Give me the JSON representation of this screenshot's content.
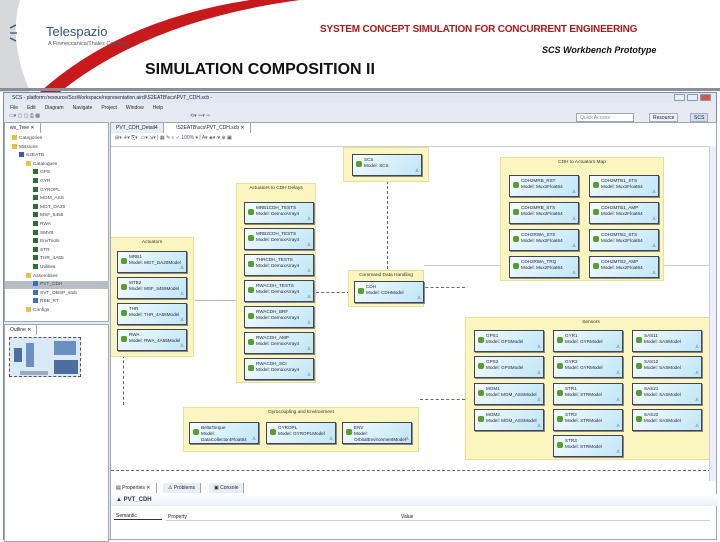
{
  "slide": {
    "logo_name": "Telespazio",
    "logo_sub": "A Finmeccanica/Thales Company",
    "title": "SYSTEM CONCEPT SIMULATION FOR CONCURRENT ENGINEERING",
    "subtitle": "SCS Workbench Prototype",
    "heading": "SIMULATION COMPOSITION II",
    "accent": "#c8191c"
  },
  "window": {
    "title": "SCS - platform:/resource/ScsWorkspace/representation.aird/\\S2EATB\\scs\\PVT_CDH.scb -",
    "menu": [
      "File",
      "Edit",
      "Diagram",
      "Navigate",
      "Project",
      "Window",
      "Help"
    ],
    "quick_access": "Quick Access",
    "persp_resource": "Resource",
    "persp_scs": "SCS"
  },
  "tree": {
    "tab": "ws_Tree",
    "items": [
      {
        "label": "Categories",
        "d": 1,
        "ic": "folder"
      },
      {
        "label": "Missions",
        "d": 1,
        "ic": "folder"
      },
      {
        "label": "S2EATB",
        "d": 2,
        "ic": "mission"
      },
      {
        "label": "Catalogues",
        "d": 3,
        "ic": "folder"
      },
      {
        "label": "GPS",
        "d": 4,
        "ic": "cat"
      },
      {
        "label": "GYR",
        "d": 4,
        "ic": "cat"
      },
      {
        "label": "GYROPL",
        "d": 4,
        "ic": "cat"
      },
      {
        "label": "MGM_ASS",
        "d": 4,
        "ic": "cat"
      },
      {
        "label": "MGT_DA20",
        "d": 4,
        "ic": "cat"
      },
      {
        "label": "MSF_5455",
        "d": 4,
        "ic": "cat"
      },
      {
        "label": "RWA",
        "d": 4,
        "ic": "cat"
      },
      {
        "label": "SMVB",
        "d": 4,
        "ic": "cat"
      },
      {
        "label": "EnvTools",
        "d": 4,
        "ic": "cat"
      },
      {
        "label": "STR",
        "d": 4,
        "ic": "cat"
      },
      {
        "label": "THR_4A55",
        "d": 4,
        "ic": "cat"
      },
      {
        "label": "Utilities",
        "d": 4,
        "ic": "cat"
      },
      {
        "label": "Assemblies",
        "d": 3,
        "ic": "folder"
      },
      {
        "label": "PVT_CDH",
        "d": 4,
        "ic": "asm",
        "sel": true
      },
      {
        "label": "SVT_OBSP_stub",
        "d": 4,
        "ic": "asm"
      },
      {
        "label": "RBB_RT",
        "d": 4,
        "ic": "asm"
      },
      {
        "label": "Configs",
        "d": 3,
        "ic": "folder"
      }
    ]
  },
  "outline": {
    "tab": "Outline"
  },
  "editor": {
    "tabs": [
      "PVT_CDH_Detail4",
      "\\S2EATB\\scs\\PVT_CDH.scb"
    ],
    "zoom": "100%"
  },
  "diagram": {
    "containers": [
      {
        "id": "scs",
        "title": "",
        "cards": [
          {
            "name": "SCS",
            "model": "Model: SCS"
          }
        ]
      },
      {
        "id": "map",
        "title": "CDH to Actuators Map",
        "cards": [
          {
            "name": "CDH2MRB_RST",
            "model": "Model: Mux2Float64"
          },
          {
            "name": "CDH2MTB1_STS",
            "model": "Model: Mux2Float64"
          },
          {
            "name": "CDH2MRB_STS",
            "model": "Model: Mux2Float64"
          },
          {
            "name": "CDH2MTB1_AMP",
            "model": "Model: Mux2Float64"
          },
          {
            "name": "CDH2RWA_STS",
            "model": "Model: Mux2Float64"
          },
          {
            "name": "CDH2MTB2_STS",
            "model": "Model: Mux2Float64"
          },
          {
            "name": "CDH2RWA_TRQ",
            "model": "Model: Mux2Float64"
          },
          {
            "name": "CDH2MTB2_AMP",
            "model": "Model: Mux2Float64"
          }
        ]
      },
      {
        "id": "delays",
        "title": "Actuators to CDH Delays",
        "cards": [
          {
            "name": "MRB1CDH_TESTS",
            "model": "Model: DemuxArray4"
          },
          {
            "name": "MRB2CDH_TESTS",
            "model": "Model: DemuxArray4"
          },
          {
            "name": "THRCDH_TESTS",
            "model": "Model: DemuxArray4"
          },
          {
            "name": "RWACDH_TESTS",
            "model": "Model: DemuxArray4"
          },
          {
            "name": "RWACDH_BRF",
            "model": "Model: DemuxArray4"
          },
          {
            "name": "RWACDH_AMP",
            "model": "Model: DemuxArray4"
          },
          {
            "name": "RWACDH_SCI",
            "model": "Model: DemuxArray4"
          }
        ]
      },
      {
        "id": "actuators",
        "title": "Actuators",
        "cards": [
          {
            "name": "MRB1",
            "model": "Model: MGT_DA20Model"
          },
          {
            "name": "MTB2",
            "model": "Model: MSF_5455Model"
          },
          {
            "name": "THR",
            "model": "Model: THR_4A55Model"
          },
          {
            "name": "RWA",
            "model": "Model: RWA_4A55Model"
          }
        ]
      },
      {
        "id": "cdh",
        "title": "Command Data Handling",
        "cards": [
          {
            "name": "CDH",
            "model": "Model: CDHModel"
          }
        ]
      },
      {
        "id": "sensors",
        "title": "Sensors",
        "cards": [
          {
            "name": "GPS1",
            "model": "Model: GPSModel"
          },
          {
            "name": "GYR1",
            "model": "Model: GYRModel"
          },
          {
            "name": "SAS11",
            "model": "Model: SASModel"
          },
          {
            "name": "GPS2",
            "model": "Model: GPSModel"
          },
          {
            "name": "GYR2",
            "model": "Model: GYRModel"
          },
          {
            "name": "SAS12",
            "model": "Model: SASModel"
          },
          {
            "name": "MGM1",
            "model": "Model: MGM_ASSModel"
          },
          {
            "name": "STR1",
            "model": "Model: STRModel"
          },
          {
            "name": "SAS21",
            "model": "Model: SASModel"
          },
          {
            "name": "MGM2",
            "model": "Model: MGM_ASSModel"
          },
          {
            "name": "STR2",
            "model": "Model: STRModel"
          },
          {
            "name": "SAS22",
            "model": "Model: SASModel"
          },
          {
            "name": "STR3",
            "model": "Model: STRModel"
          }
        ]
      },
      {
        "id": "gyro",
        "title": "Gyrocoupling and Environment",
        "cards": [
          {
            "name": "BeltaTorque",
            "model": "Model: DataCollector4Float64"
          },
          {
            "name": "GYROPL",
            "model": "Model: GYROPLModel"
          },
          {
            "name": "ENV",
            "model": "Model: OrbitalEnvironmentModel"
          }
        ]
      }
    ]
  },
  "properties": {
    "tabs": [
      "Properties",
      "Problems",
      "Console"
    ],
    "title": "PVT_CDH",
    "section": "Semantic",
    "col_property": "Property",
    "col_value": "Value"
  }
}
